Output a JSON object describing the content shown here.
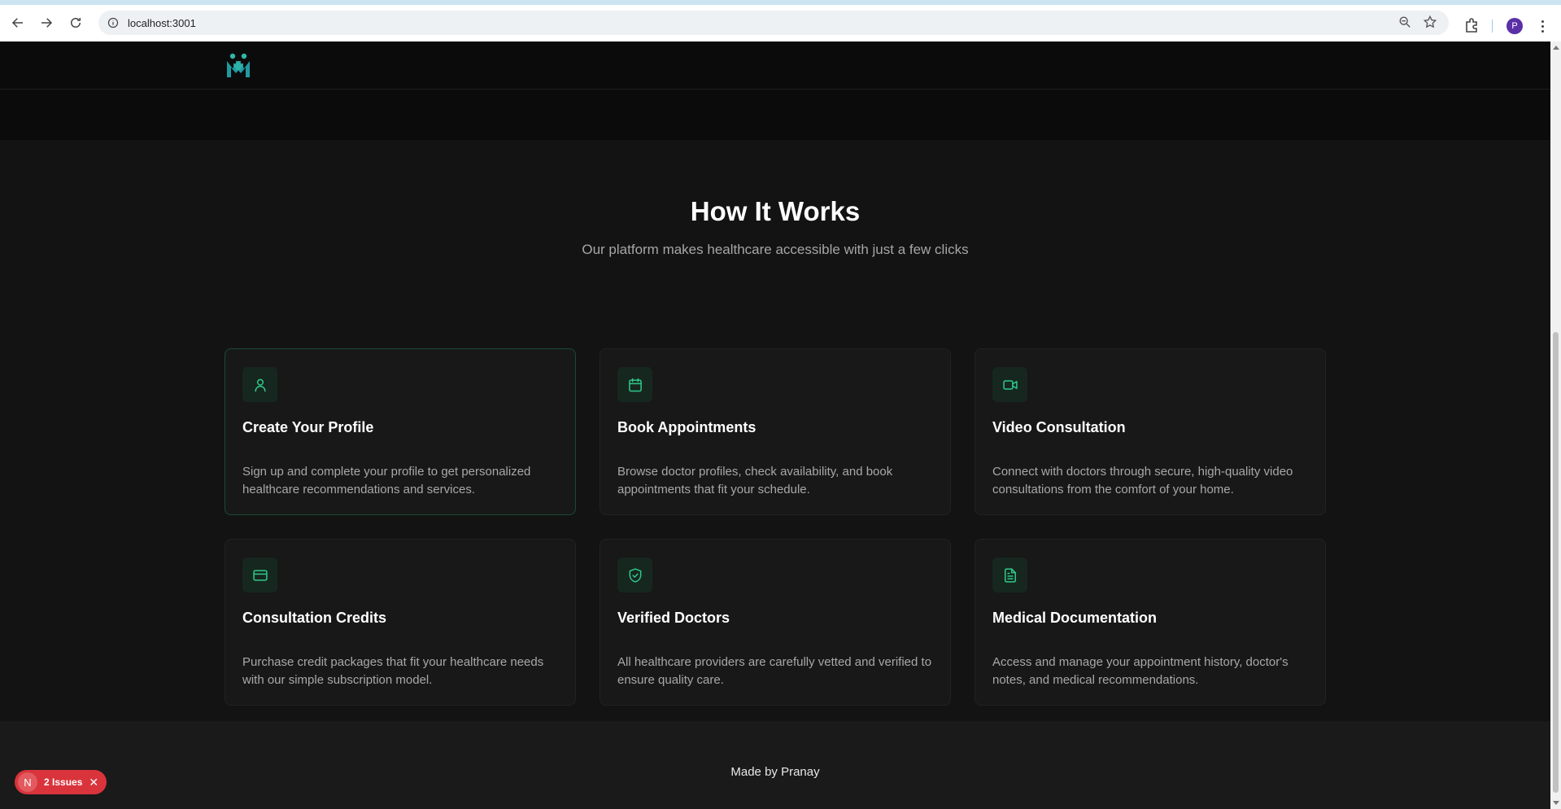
{
  "browser": {
    "url": "localhost:3001",
    "profile_initial": "P"
  },
  "section": {
    "title": "How It Works",
    "subtitle": "Our platform makes healthcare accessible with just a few clicks"
  },
  "cards": [
    {
      "title": "Create Your Profile",
      "desc": "Sign up and complete your profile to get personalized healthcare recommendations and services.",
      "icon": "user-icon"
    },
    {
      "title": "Book Appointments",
      "desc": "Browse doctor profiles, check availability, and book appointments that fit your schedule.",
      "icon": "calendar-icon"
    },
    {
      "title": "Video Consultation",
      "desc": "Connect with doctors through secure, high-quality video consultations from the comfort of your home.",
      "icon": "video-icon"
    },
    {
      "title": "Consultation Credits",
      "desc": "Purchase credit packages that fit your healthcare needs with our simple subscription model.",
      "icon": "credit-card-icon"
    },
    {
      "title": "Verified Doctors",
      "desc": "All healthcare providers are carefully vetted and verified to ensure quality care.",
      "icon": "shield-check-icon"
    },
    {
      "title": "Medical Documentation",
      "desc": "Access and manage your appointment history, doctor's notes, and medical recommendations.",
      "icon": "file-text-icon"
    }
  ],
  "footer": {
    "text": "Made by Pranay"
  },
  "dev_overlay": {
    "badge": "N",
    "label": "2 Issues",
    "close": "✕"
  },
  "colors": {
    "accent": "#2fc98a",
    "background": "#131313",
    "card": "#181818"
  }
}
